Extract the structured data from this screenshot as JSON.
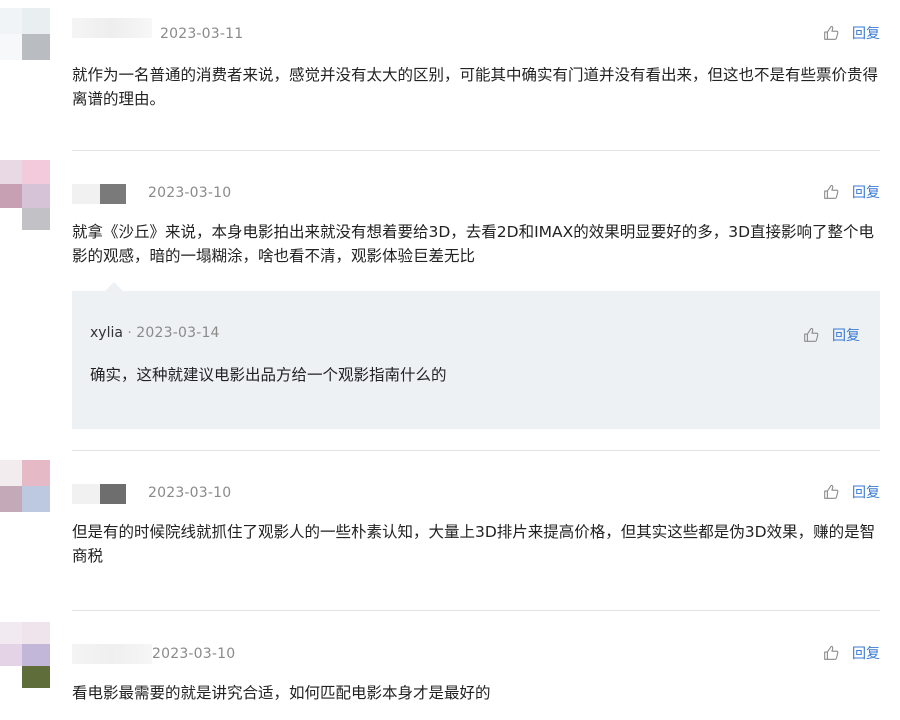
{
  "icons": {
    "like": "thumbs-up-icon"
  },
  "colors": {
    "accent": "#3a7bd5",
    "reply_bg": "#eef1f4",
    "meta": "#8a8a8a"
  },
  "comments": [
    {
      "date": "2023-03-11",
      "text": "就作为一名普通的消费者来说，感觉并没有太大的区别，可能其中确实有门道并没有看出来，但这也不是有些票价贵得离谱的理由。",
      "reply_label": "回复"
    },
    {
      "date": "2023-03-10",
      "text": "就拿《沙丘》来说，本身电影拍出来就没有想着要给3D，去看2D和IMAX的效果明显要好的多，3D直接影响了整个电影的观感，暗的一塌糊涂，啥也看不清，观影体验巨差无比",
      "reply_label": "回复",
      "reply": {
        "user": "xylia",
        "separator": "·",
        "date": "2023-03-14",
        "text": "确实，这种就建议电影出品方给一个观影指南什么的",
        "reply_label": "回复"
      }
    },
    {
      "date": "2023-03-10",
      "text": "但是有的时候院线就抓住了观影人的一些朴素认知，大量上3D排片来提高价格，但其实这些都是伪3D效果，赚的是智商税",
      "reply_label": "回复"
    },
    {
      "date": "2023-03-10",
      "text": "看电影最需要的就是讲究合适，如何匹配电影本身才是最好的",
      "reply_label": "回复"
    }
  ]
}
